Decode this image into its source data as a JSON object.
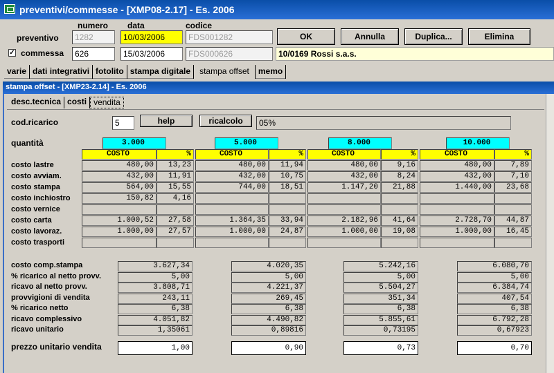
{
  "window": {
    "title": "preventivi/commesse - [XMP08-2.17] - Es. 2006"
  },
  "header": {
    "col_numero": "numero",
    "col_data": "data",
    "col_codice": "codice",
    "preventivo": {
      "label": "preventivo",
      "numero": "1282",
      "data": "10/03/2006",
      "codice": "FDS001282"
    },
    "commessa": {
      "label": "commessa",
      "checked": "✓",
      "numero": "626",
      "data": "15/03/2006",
      "codice": "FDS000626",
      "cliente": "10/0169  Rossi s.a.s."
    },
    "buttons": {
      "ok": "OK",
      "annulla": "Annulla",
      "duplica": "Duplica...",
      "elimina": "Elimina"
    }
  },
  "tabs": [
    "varie",
    "dati integrativi",
    "fotolito",
    "stampa digitale",
    "stampa offset",
    "memo"
  ],
  "sub": {
    "title": "stampa offset - [XMP23-2.14] - Es. 2006",
    "tabs": [
      "desc.tecnica",
      "costi",
      "vendita"
    ],
    "cod_ricarico": {
      "label": "cod.ricarico",
      "value": "5",
      "help": "help",
      "ricalcolo": "ricalcolo",
      "desc": "05%"
    },
    "quantita_label": "quantità",
    "quantities": [
      "3.000",
      "5.000",
      "8.000",
      "10.000"
    ],
    "col_costo": "COSTO",
    "col_pct": "%",
    "cost_rows": [
      {
        "label": "costo lastre",
        "vals": [
          [
            "480,00",
            "13,23"
          ],
          [
            "480,00",
            "11,94"
          ],
          [
            "480,00",
            "9,16"
          ],
          [
            "480,00",
            "7,89"
          ]
        ]
      },
      {
        "label": "costo avviam.",
        "vals": [
          [
            "432,00",
            "11,91"
          ],
          [
            "432,00",
            "10,75"
          ],
          [
            "432,00",
            "8,24"
          ],
          [
            "432,00",
            "7,10"
          ]
        ]
      },
      {
        "label": "costo stampa",
        "vals": [
          [
            "564,00",
            "15,55"
          ],
          [
            "744,00",
            "18,51"
          ],
          [
            "1.147,20",
            "21,88"
          ],
          [
            "1.440,00",
            "23,68"
          ]
        ]
      },
      {
        "label": "costo inchiostro",
        "vals": [
          [
            "150,82",
            "4,16"
          ],
          [
            "",
            ""
          ],
          [
            "",
            ""
          ],
          [
            "",
            ""
          ]
        ]
      },
      {
        "label": "costo vernice",
        "vals": [
          [
            "",
            ""
          ],
          [
            "",
            ""
          ],
          [
            "",
            ""
          ],
          [
            "",
            ""
          ]
        ]
      },
      {
        "label": "costo carta",
        "vals": [
          [
            "1.000,52",
            "27,58"
          ],
          [
            "1.364,35",
            "33,94"
          ],
          [
            "2.182,96",
            "41,64"
          ],
          [
            "2.728,70",
            "44,87"
          ]
        ]
      },
      {
        "label": "costo lavoraz.",
        "vals": [
          [
            "1.000,00",
            "27,57"
          ],
          [
            "1.000,00",
            "24,87"
          ],
          [
            "1.000,00",
            "19,08"
          ],
          [
            "1.000,00",
            "16,45"
          ]
        ]
      },
      {
        "label": "costo trasporti",
        "vals": [
          [
            "",
            ""
          ],
          [
            "",
            ""
          ],
          [
            "",
            ""
          ],
          [
            "",
            ""
          ]
        ]
      }
    ],
    "summary_rows": [
      {
        "label": "costo comp.stampa",
        "vals": [
          "3.627,34",
          "4.020,35",
          "5.242,16",
          "6.080,70"
        ]
      },
      {
        "label": "% ricarico al netto provv.",
        "vals": [
          "5,00",
          "5,00",
          "5,00",
          "5,00"
        ]
      },
      {
        "label": "ricavo al netto provv.",
        "vals": [
          "3.808,71",
          "4.221,37",
          "5.504,27",
          "6.384,74"
        ]
      },
      {
        "label": "provvigioni di vendita",
        "vals": [
          "243,11",
          "269,45",
          "351,34",
          "407,54"
        ]
      },
      {
        "label": "% ricarico netto",
        "vals": [
          "6,38",
          "6,38",
          "6,38",
          "6,38"
        ]
      },
      {
        "label": "ricavo complessivo",
        "vals": [
          "4.051,82",
          "4.490,82",
          "5.855,61",
          "6.792,28"
        ]
      },
      {
        "label": "ricavo unitario",
        "vals": [
          "1,35061",
          "0,89816",
          "0,73195",
          "0,67923"
        ]
      }
    ],
    "prezzo": {
      "label": "prezzo unitario vendita",
      "vals": [
        "1,00",
        "0,90",
        "0,73",
        "0,70"
      ]
    }
  }
}
